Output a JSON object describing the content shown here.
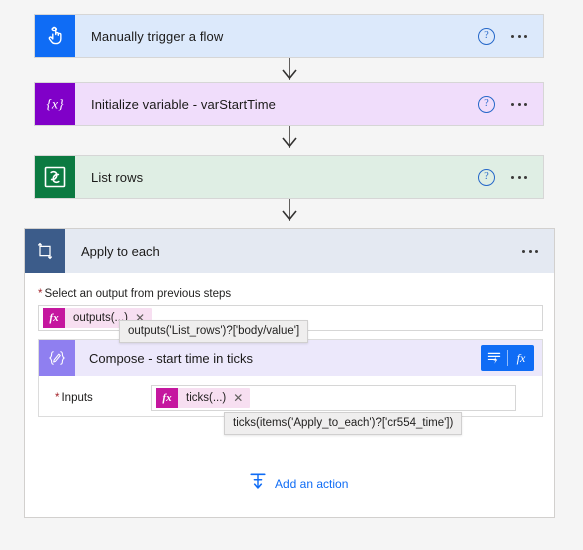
{
  "flow": {
    "steps": [
      {
        "id": "trigger",
        "name": "Manually trigger a flow",
        "icon": "tap-hand-icon",
        "icon_bg": "#0f6cf5",
        "card_bg": "#dce9fb",
        "has_help": true,
        "has_menu": true
      },
      {
        "id": "init-variable",
        "name": "Initialize variable - varStartTime",
        "icon": "variable-braces-icon",
        "icon_bg": "#8000c8",
        "card_bg": "#f0ddfb",
        "has_help": true,
        "has_menu": true
      },
      {
        "id": "list-rows",
        "name": "List rows",
        "icon": "dataverse-icon",
        "icon_bg": "#0b7a41",
        "card_bg": "#dfeee4",
        "has_help": true,
        "has_menu": true
      }
    ]
  },
  "loop": {
    "title": "Apply to each",
    "icon": "loop-repeat-icon",
    "icon_bg": "#3c5c8a",
    "header_bg": "#e4e9f2",
    "menu_label": "more-commands",
    "output_field": {
      "label": "Select an output from previous steps",
      "required_marker": "*",
      "token": {
        "fx_label": "fx",
        "text": "outputs(...)",
        "remove_label": "✕"
      },
      "tooltip": "outputs('List_rows')?['body/value']"
    },
    "compose": {
      "title": "Compose - start time in ticks",
      "icon": "compose-braces-pencil-icon",
      "icon_bg": "#8f7ff0",
      "header_bg": "#ece8fb",
      "dynamic_button": {
        "dynamic_icon": "dynamic-content-icon",
        "fx_label": "fx",
        "bg": "#0f6cf5"
      },
      "inputs_field": {
        "label": "Inputs",
        "required_marker": "*",
        "token": {
          "fx_label": "fx",
          "text": "ticks(...)",
          "remove_label": "✕"
        },
        "tooltip": "ticks(items('Apply_to_each')?['cr554_time'])"
      }
    },
    "add_action": {
      "label": "Add an action",
      "icon": "insert-action-icon",
      "color": "#0f6cf5"
    }
  },
  "icons": {
    "help": "?",
    "help_name": "help-icon",
    "menu_name": "more-options-icon"
  }
}
